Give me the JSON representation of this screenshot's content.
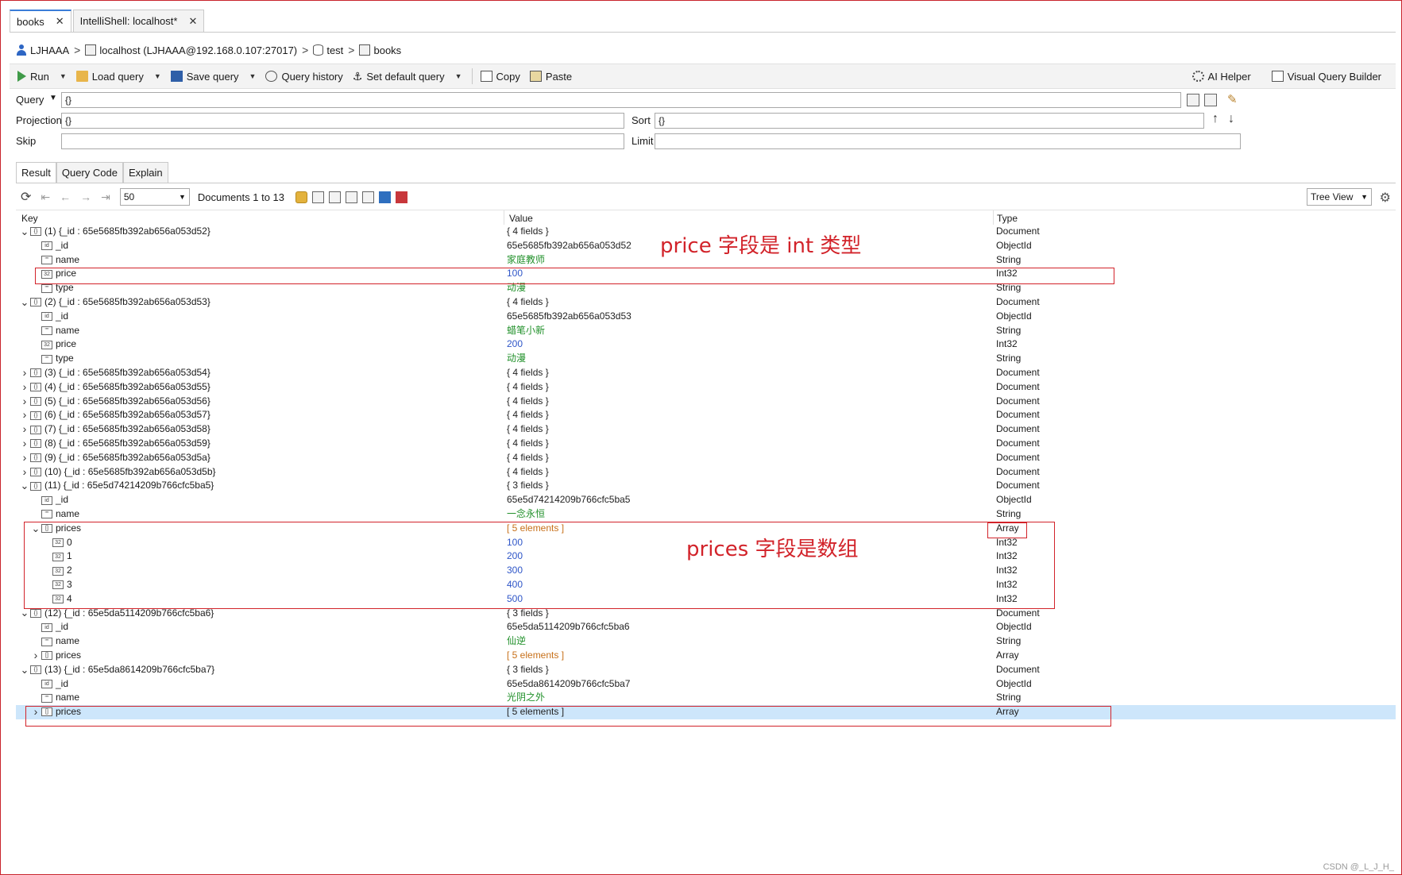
{
  "tabs": [
    {
      "label": "books",
      "close": "✕",
      "active": true
    },
    {
      "label": "IntelliShell: localhost*",
      "close": "✕",
      "active": false
    }
  ],
  "breadcrumb": {
    "user": "LJHAAA",
    "server": "localhost (LJHAAA@192.168.0.107:27017)",
    "database": "test",
    "collection": "books",
    "separator": ">"
  },
  "toolbar": {
    "run": "Run",
    "load_query": "Load query",
    "save_query": "Save query",
    "query_history": "Query history",
    "set_default_query": "Set default query",
    "copy": "Copy",
    "paste": "Paste",
    "ai_helper": "AI Helper",
    "visual_query_builder": "Visual Query Builder"
  },
  "query": {
    "query_label": "Query",
    "query_value": "{}",
    "projection_label": "Projection",
    "projection_value": "{}",
    "sort_label": "Sort",
    "sort_value": "{}",
    "skip_label": "Skip",
    "skip_value": "",
    "limit_label": "Limit",
    "limit_value": ""
  },
  "result_tabs": [
    "Result",
    "Query Code",
    "Explain"
  ],
  "result_toolbar": {
    "page_size": "50",
    "documents_label": "Documents 1 to 13",
    "view_mode": "Tree View"
  },
  "grid": {
    "headers": {
      "key": "Key",
      "value": "Value",
      "type": "Type"
    },
    "rows": [
      {
        "depth": 0,
        "twisty": "open",
        "icon": "{}",
        "key": "(1) {_id : 65e5685fb392ab656a053d52}",
        "value": "{ 4 fields }",
        "vclass": "v-plain",
        "type": "Document"
      },
      {
        "depth": 1,
        "twisty": "",
        "icon": "id",
        "key": "_id",
        "value": "65e5685fb392ab656a053d52",
        "vclass": "v-plain",
        "type": "ObjectId"
      },
      {
        "depth": 1,
        "twisty": "",
        "icon": "\"\"",
        "key": "name",
        "value": "家庭教师",
        "vclass": "v-str",
        "type": "String"
      },
      {
        "depth": 1,
        "twisty": "",
        "icon": "32",
        "key": "price",
        "value": "100",
        "vclass": "v-num",
        "type": "Int32"
      },
      {
        "depth": 1,
        "twisty": "",
        "icon": "\"\"",
        "key": "type",
        "value": "动漫",
        "vclass": "v-str",
        "type": "String"
      },
      {
        "depth": 0,
        "twisty": "open",
        "icon": "{}",
        "key": "(2) {_id : 65e5685fb392ab656a053d53}",
        "value": "{ 4 fields }",
        "vclass": "v-plain",
        "type": "Document"
      },
      {
        "depth": 1,
        "twisty": "",
        "icon": "id",
        "key": "_id",
        "value": "65e5685fb392ab656a053d53",
        "vclass": "v-plain",
        "type": "ObjectId"
      },
      {
        "depth": 1,
        "twisty": "",
        "icon": "\"\"",
        "key": "name",
        "value": "蜡笔小新",
        "vclass": "v-str",
        "type": "String"
      },
      {
        "depth": 1,
        "twisty": "",
        "icon": "32",
        "key": "price",
        "value": "200",
        "vclass": "v-num",
        "type": "Int32"
      },
      {
        "depth": 1,
        "twisty": "",
        "icon": "\"\"",
        "key": "type",
        "value": "动漫",
        "vclass": "v-str",
        "type": "String"
      },
      {
        "depth": 0,
        "twisty": "closed",
        "icon": "{}",
        "key": "(3) {_id : 65e5685fb392ab656a053d54}",
        "value": "{ 4 fields }",
        "vclass": "v-plain",
        "type": "Document"
      },
      {
        "depth": 0,
        "twisty": "closed",
        "icon": "{}",
        "key": "(4) {_id : 65e5685fb392ab656a053d55}",
        "value": "{ 4 fields }",
        "vclass": "v-plain",
        "type": "Document"
      },
      {
        "depth": 0,
        "twisty": "closed",
        "icon": "{}",
        "key": "(5) {_id : 65e5685fb392ab656a053d56}",
        "value": "{ 4 fields }",
        "vclass": "v-plain",
        "type": "Document"
      },
      {
        "depth": 0,
        "twisty": "closed",
        "icon": "{}",
        "key": "(6) {_id : 65e5685fb392ab656a053d57}",
        "value": "{ 4 fields }",
        "vclass": "v-plain",
        "type": "Document"
      },
      {
        "depth": 0,
        "twisty": "closed",
        "icon": "{}",
        "key": "(7) {_id : 65e5685fb392ab656a053d58}",
        "value": "{ 4 fields }",
        "vclass": "v-plain",
        "type": "Document"
      },
      {
        "depth": 0,
        "twisty": "closed",
        "icon": "{}",
        "key": "(8) {_id : 65e5685fb392ab656a053d59}",
        "value": "{ 4 fields }",
        "vclass": "v-plain",
        "type": "Document"
      },
      {
        "depth": 0,
        "twisty": "closed",
        "icon": "{}",
        "key": "(9) {_id : 65e5685fb392ab656a053d5a}",
        "value": "{ 4 fields }",
        "vclass": "v-plain",
        "type": "Document"
      },
      {
        "depth": 0,
        "twisty": "closed",
        "icon": "{}",
        "key": "(10) {_id : 65e5685fb392ab656a053d5b}",
        "value": "{ 4 fields }",
        "vclass": "v-plain",
        "type": "Document"
      },
      {
        "depth": 0,
        "twisty": "open",
        "icon": "{}",
        "key": "(11) {_id : 65e5d74214209b766cfc5ba5}",
        "value": "{ 3 fields }",
        "vclass": "v-plain",
        "type": "Document"
      },
      {
        "depth": 1,
        "twisty": "",
        "icon": "id",
        "key": "_id",
        "value": "65e5d74214209b766cfc5ba5",
        "vclass": "v-plain",
        "type": "ObjectId"
      },
      {
        "depth": 1,
        "twisty": "",
        "icon": "\"\"",
        "key": "name",
        "value": "一念永恒",
        "vclass": "v-str",
        "type": "String"
      },
      {
        "depth": 1,
        "twisty": "open",
        "icon": "[]",
        "key": "prices",
        "value": "[ 5 elements ]",
        "vclass": "v-arr",
        "type": "Array"
      },
      {
        "depth": 2,
        "twisty": "",
        "icon": "32",
        "key": "0",
        "value": "100",
        "vclass": "v-num",
        "type": "Int32"
      },
      {
        "depth": 2,
        "twisty": "",
        "icon": "32",
        "key": "1",
        "value": "200",
        "vclass": "v-num",
        "type": "Int32"
      },
      {
        "depth": 2,
        "twisty": "",
        "icon": "32",
        "key": "2",
        "value": "300",
        "vclass": "v-num",
        "type": "Int32"
      },
      {
        "depth": 2,
        "twisty": "",
        "icon": "32",
        "key": "3",
        "value": "400",
        "vclass": "v-num",
        "type": "Int32"
      },
      {
        "depth": 2,
        "twisty": "",
        "icon": "32",
        "key": "4",
        "value": "500",
        "vclass": "v-num",
        "type": "Int32"
      },
      {
        "depth": 0,
        "twisty": "open",
        "icon": "{}",
        "key": "(12) {_id : 65e5da5114209b766cfc5ba6}",
        "value": "{ 3 fields }",
        "vclass": "v-plain",
        "type": "Document"
      },
      {
        "depth": 1,
        "twisty": "",
        "icon": "id",
        "key": "_id",
        "value": "65e5da5114209b766cfc5ba6",
        "vclass": "v-plain",
        "type": "ObjectId"
      },
      {
        "depth": 1,
        "twisty": "",
        "icon": "\"\"",
        "key": "name",
        "value": "仙逆",
        "vclass": "v-str",
        "type": "String"
      },
      {
        "depth": 1,
        "twisty": "closed",
        "icon": "[]",
        "key": "prices",
        "value": "[ 5 elements ]",
        "vclass": "v-arr",
        "type": "Array"
      },
      {
        "depth": 0,
        "twisty": "open",
        "icon": "{}",
        "key": "(13) {_id : 65e5da8614209b766cfc5ba7}",
        "value": "{ 3 fields }",
        "vclass": "v-plain",
        "type": "Document"
      },
      {
        "depth": 1,
        "twisty": "",
        "icon": "id",
        "key": "_id",
        "value": "65e5da8614209b766cfc5ba7",
        "vclass": "v-plain",
        "type": "ObjectId"
      },
      {
        "depth": 1,
        "twisty": "",
        "icon": "\"\"",
        "key": "name",
        "value": "光阴之外",
        "vclass": "v-str",
        "type": "String"
      },
      {
        "depth": 1,
        "twisty": "closed",
        "icon": "[]",
        "key": "prices",
        "value": "[ 5 elements ]",
        "vclass": "v-plain",
        "type": "Array",
        "selected": true
      }
    ]
  },
  "annotations": {
    "price_note": "price 字段是 int 类型",
    "prices_note": "prices 字段是数组"
  },
  "watermark": "CSDN @_L_J_H_",
  "colors": {
    "accent": "#3b7dd8",
    "annotation": "#d2232a",
    "selected_row": "#cde6fb",
    "string": "#22912b",
    "number": "#2f56c8",
    "array": "#c7701a"
  }
}
